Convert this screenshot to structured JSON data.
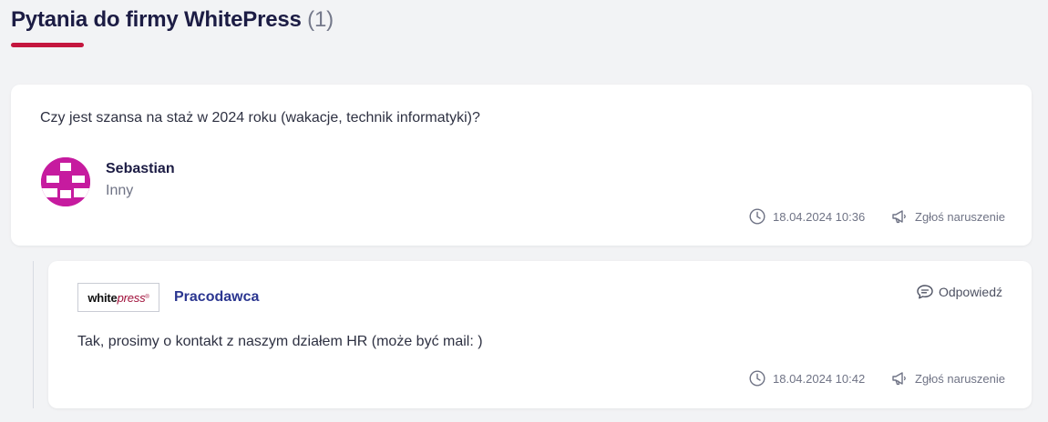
{
  "header": {
    "title": "Pytania do firmy WhitePress",
    "count": "(1)"
  },
  "question": {
    "text": "Czy jest szansa na staż w 2024 roku (wakacje, technik informatyki)?",
    "author": "Sebastian",
    "author_role": "Inny",
    "timestamp": "18.04.2024 10:36",
    "report_label": "Zgłoś naruszenie",
    "avatar_color": "#c61b9f"
  },
  "answer": {
    "logo": {
      "bold": "white",
      "italic": "press",
      "mark": "®"
    },
    "author_label": "Pracodawca",
    "reply_label": "Odpowiedź",
    "text": "Tak, prosimy o kontakt z naszym działem HR (może być mail: )",
    "timestamp": "18.04.2024 10:42",
    "report_label": "Zgłoś naruszenie"
  },
  "colors": {
    "accent": "#c4163e",
    "title": "#1c1c44",
    "employer": "#2b3690",
    "background": "#f2f3f5"
  },
  "icons": [
    "clock-icon",
    "megaphone-icon",
    "chat-bubble-icon"
  ]
}
